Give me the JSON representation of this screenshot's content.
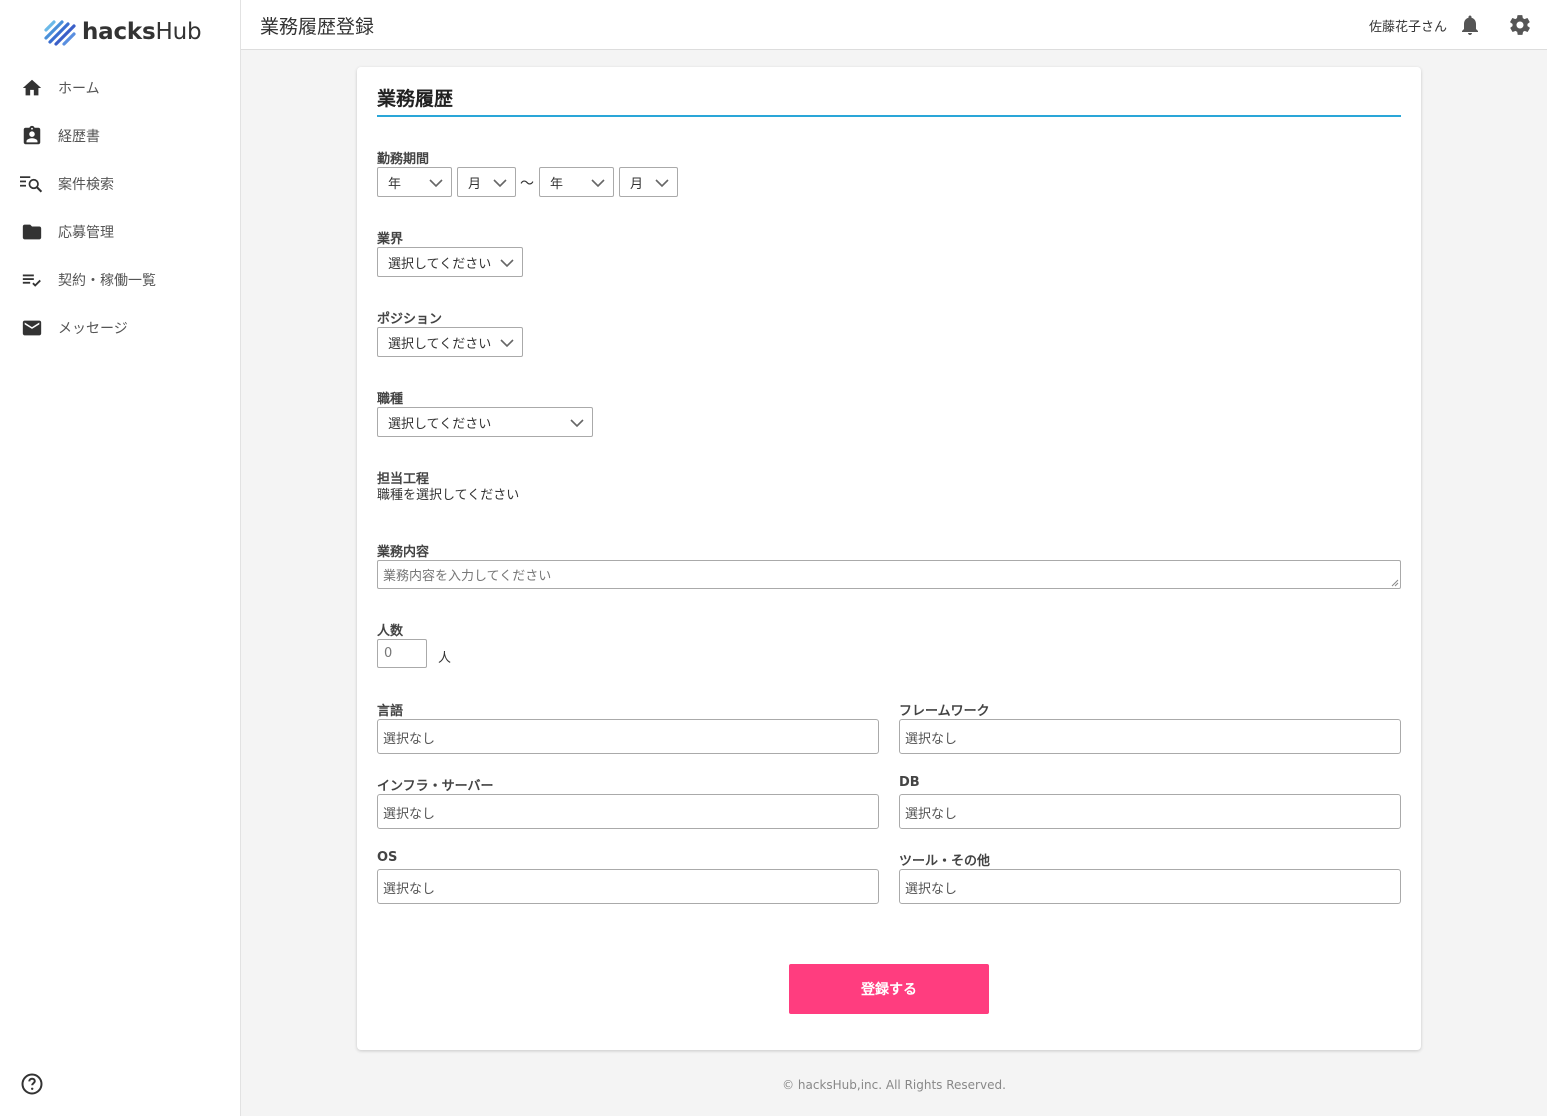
{
  "brand": {
    "name_bold": "hacks",
    "name_rest": "Hub"
  },
  "sidebar": {
    "items": [
      {
        "label": "ホーム",
        "icon": "home-icon"
      },
      {
        "label": "経歴書",
        "icon": "resume-icon"
      },
      {
        "label": "案件検索",
        "icon": "list-search-icon"
      },
      {
        "label": "応募管理",
        "icon": "folder-icon"
      },
      {
        "label": "契約・稼働一覧",
        "icon": "checklist-icon"
      },
      {
        "label": "メッセージ",
        "icon": "mail-icon"
      }
    ],
    "help_icon": "help-icon"
  },
  "header": {
    "title": "業務履歴登録",
    "user": "佐藤花子さん"
  },
  "form": {
    "title": "業務履歴",
    "period": {
      "label": "勤務期間",
      "start_year": "年",
      "start_month": "月",
      "separator": "～",
      "end_year": "年",
      "end_month": "月"
    },
    "industry": {
      "label": "業界",
      "value": "選択してください"
    },
    "position": {
      "label": "ポジション",
      "value": "選択してください"
    },
    "job_type": {
      "label": "職種",
      "value": "選択してください"
    },
    "process": {
      "label": "担当工程",
      "hint": "職種を選択してください"
    },
    "content": {
      "label": "業務内容",
      "placeholder": "業務内容を入力してください"
    },
    "headcount": {
      "label": "人数",
      "placeholder": "0",
      "unit": "人"
    },
    "skills": [
      {
        "label": "言語",
        "placeholder": "選択なし"
      },
      {
        "label": "フレームワーク",
        "placeholder": "選択なし"
      },
      {
        "label": "インフラ・サーバー",
        "placeholder": "選択なし"
      },
      {
        "label": "DB",
        "placeholder": "選択なし"
      },
      {
        "label": "OS",
        "placeholder": "選択なし"
      },
      {
        "label": "ツール・その他",
        "placeholder": "選択なし"
      }
    ],
    "submit_label": "登録する"
  },
  "footer": {
    "copyright": "© hacksHub,inc. All Rights Reserved."
  },
  "colors": {
    "accent_blue": "#2aa6d8",
    "submit_pink": "#ff3d7f"
  }
}
